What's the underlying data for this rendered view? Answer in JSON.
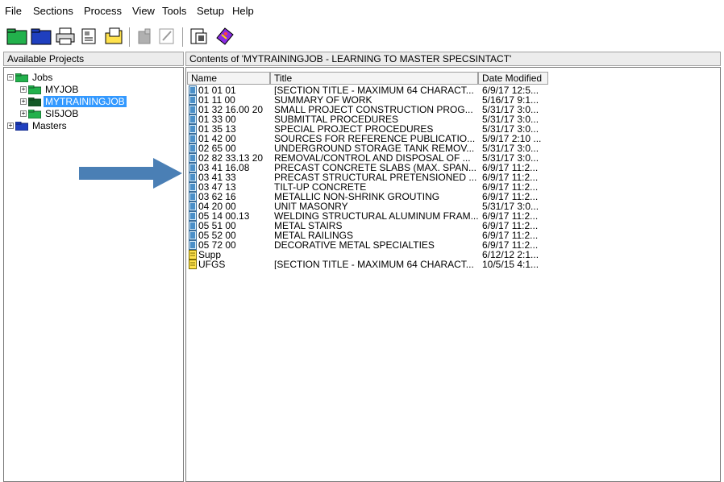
{
  "menu": [
    "File",
    "Sections",
    "Process",
    "View",
    "Tools",
    "Setup",
    "Help"
  ],
  "toolbar": {
    "buttons": [
      "new-job-icon",
      "open-folder-icon",
      "print-icon",
      "properties-icon",
      "open-file-icon",
      "disabled-tool-icon",
      "edit-disabled-icon",
      "clipboard-icon",
      "book-icon"
    ]
  },
  "left_header": "Available Projects",
  "tree": {
    "jobs": "Jobs",
    "children": [
      "MYJOB",
      "MYTRAININGJOB",
      "SI5JOB"
    ],
    "masters": "Masters"
  },
  "right_header": "Contents of 'MYTRAININGJOB - LEARNING TO MASTER SPECSINTACT'",
  "columns": [
    "Name",
    "Title",
    "Date Modified"
  ],
  "rows": [
    {
      "name": "01 01 01",
      "title": "[SECTION TITLE - MAXIMUM 64 CHARACT...",
      "date": "6/9/17 12:5..."
    },
    {
      "name": "01 11 00",
      "title": "SUMMARY OF WORK",
      "date": "5/16/17 9:1..."
    },
    {
      "name": "01 32 16.00 20",
      "title": "SMALL PROJECT CONSTRUCTION PROG...",
      "date": "5/31/17 3:0..."
    },
    {
      "name": "01 33 00",
      "title": "SUBMITTAL PROCEDURES",
      "date": "5/31/17 3:0..."
    },
    {
      "name": "01 35 13",
      "title": "SPECIAL PROJECT PROCEDURES",
      "date": "5/31/17 3:0..."
    },
    {
      "name": "01 42 00",
      "title": "SOURCES FOR REFERENCE PUBLICATIO...",
      "date": "5/9/17 2:10 ..."
    },
    {
      "name": "02 65 00",
      "title": "UNDERGROUND STORAGE TANK REMOV...",
      "date": "5/31/17 3:0..."
    },
    {
      "name": "02 82 33.13 20",
      "title": "REMOVAL/CONTROL AND DISPOSAL OF ...",
      "date": "5/31/17 3:0..."
    },
    {
      "name": "03 41 16.08",
      "title": "PRECAST CONCRETE SLABS (MAX. SPAN...",
      "date": "6/9/17 11:2..."
    },
    {
      "name": "03 41 33",
      "title": "PRECAST STRUCTURAL PRETENSIONED ...",
      "date": "6/9/17 11:2..."
    },
    {
      "name": "03 47 13",
      "title": "TILT-UP CONCRETE",
      "date": "6/9/17 11:2..."
    },
    {
      "name": "03 62 16",
      "title": "METALLIC NON-SHRINK GROUTING",
      "date": "6/9/17 11:2..."
    },
    {
      "name": "04 20 00",
      "title": "UNIT MASONRY",
      "date": "5/31/17 3:0..."
    },
    {
      "name": "05 14 00.13",
      "title": "WELDING STRUCTURAL ALUMINUM FRAM...",
      "date": "6/9/17 11:2..."
    },
    {
      "name": "05 51 00",
      "title": "METAL STAIRS",
      "date": "6/9/17 11:2..."
    },
    {
      "name": "05 52 00",
      "title": "METAL RAILINGS",
      "date": "6/9/17 11:2..."
    },
    {
      "name": "05 72 00",
      "title": "DECORATIVE METAL SPECIALTIES",
      "date": "6/9/17 11:2..."
    },
    {
      "name": "Supp",
      "title": "",
      "date": "6/12/12 2:1..."
    },
    {
      "name": "UFGS",
      "title": "[SECTION TITLE - MAXIMUM 64 CHARACT...",
      "date": "10/5/15 4:1..."
    }
  ],
  "colors": {
    "selection": "#3399ff",
    "arrow": "#4a7fb5",
    "folder_green": "#22b14c",
    "folder_blue": "#1f3fbf"
  }
}
